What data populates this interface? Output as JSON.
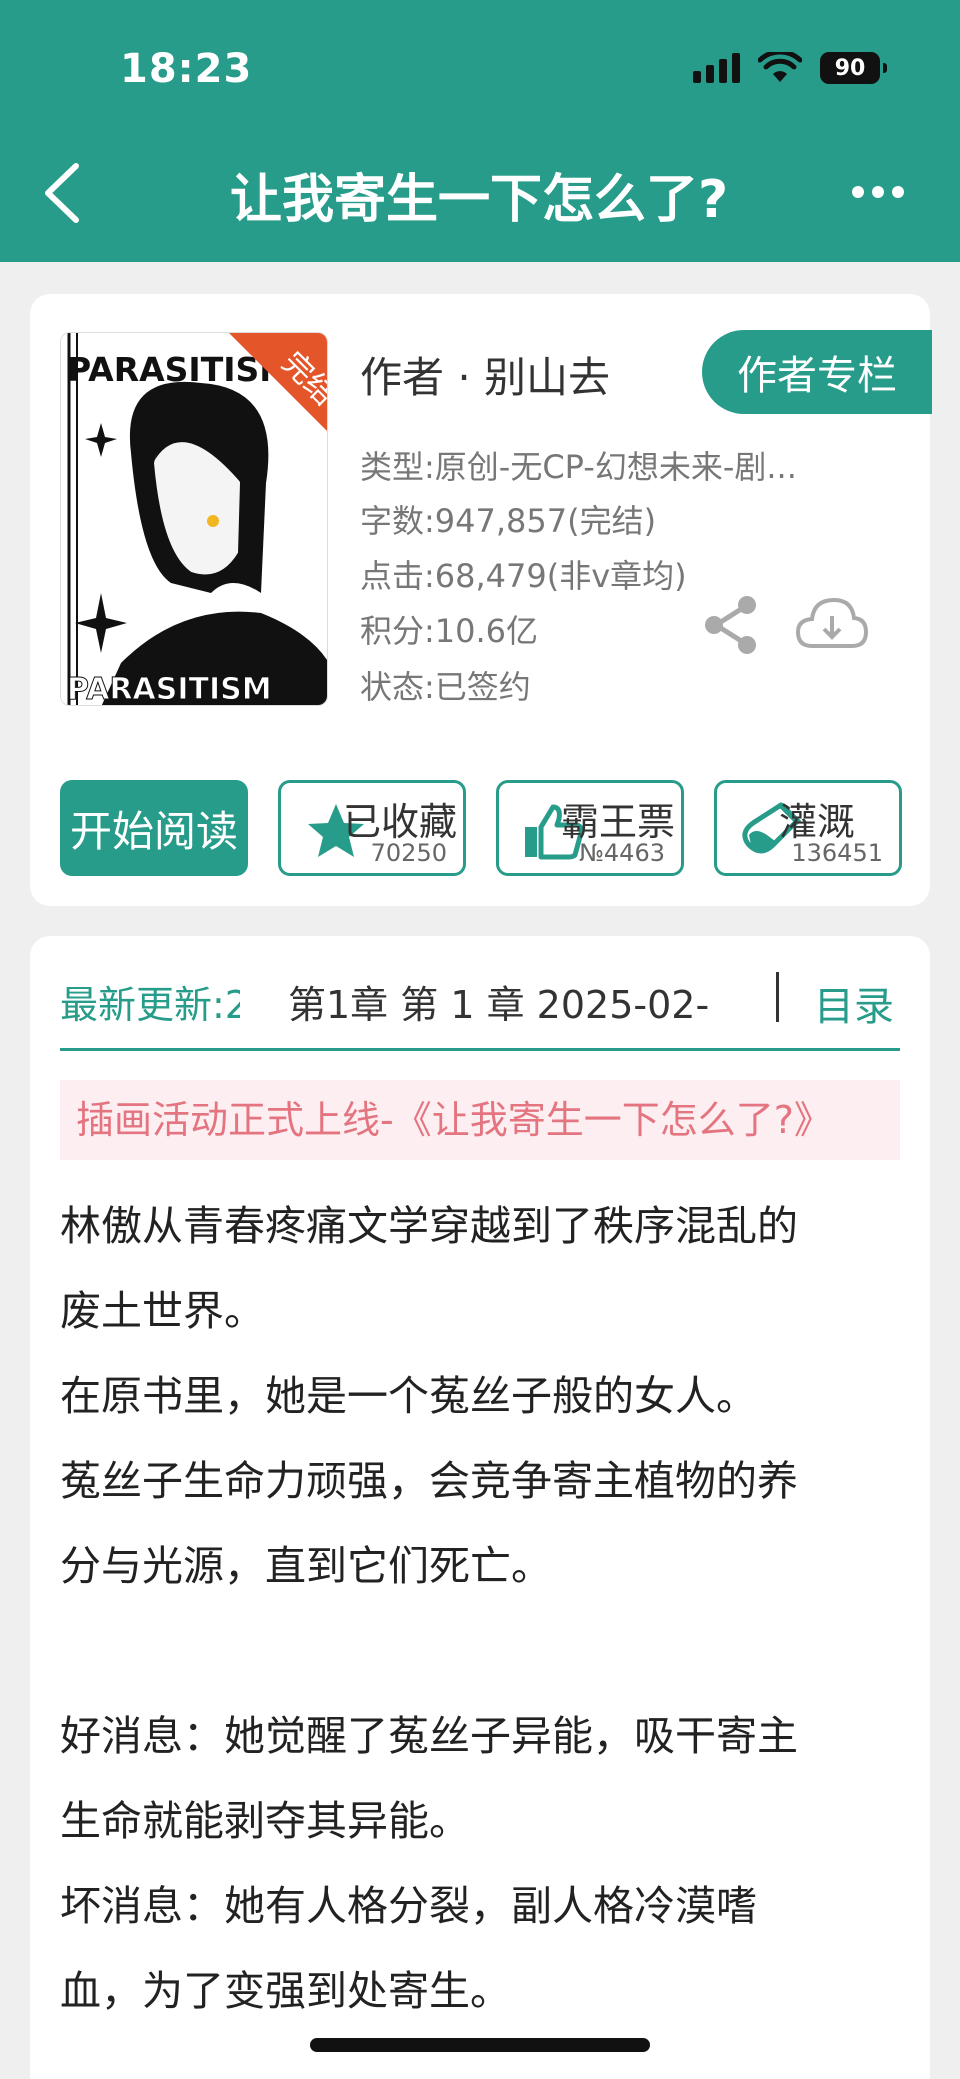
{
  "status": {
    "time": "18:23",
    "battery": "90"
  },
  "nav": {
    "title": "让我寄生一下怎么了?"
  },
  "book": {
    "cover_text_top": "PARASITISM",
    "cover_text_bottom": "PARASITISM",
    "cover_badge": "完结",
    "author": "作者 · 别山去",
    "author_column_button": "作者专栏",
    "type": "类型:原创-无CP-幻想未来-剧...",
    "word_count": "字数:947,857(完结)",
    "clicks": "点击:68,479(非v章均)",
    "score": "积分:10.6亿",
    "status": "状态:已签约"
  },
  "actions": {
    "start_reading": "开始阅读",
    "collected_label": "已收藏",
    "collected_count": "70250",
    "vote_label": "霸王票",
    "vote_count": "№4463",
    "nutrient_label": "灌溉",
    "nutrient_count": "136451"
  },
  "update": {
    "label": "最新更新:2",
    "text": "第1章 第 1 章 2025-02-",
    "toc": "目录"
  },
  "promo": "插画活动正式上线-《让我寄生一下怎么了?》",
  "intro": "林傲从青春疼痛文学穿越到了秩序混乱的\n废土世界。\n在原书里，她是一个菟丝子般的女人。\n菟丝子生命力顽强，会竞争寄主植物的养\n分与光源，直到它们死亡。\n\n好消息：她觉醒了菟丝子异能，吸干寄主\n生命就能剥夺其异能。\n坏消息：她有人格分裂，副人格冷漠嗜\n血，为了变强到处寄生。",
  "colors": {
    "accent": "#279c8a",
    "promo_bg": "#fdeef1",
    "promo_text": "#e47580",
    "badge": "#e4552a"
  },
  "icons": [
    "back-icon",
    "more-icon",
    "share-icon",
    "cloud-download-icon",
    "star-icon",
    "thumbs-up-icon",
    "flask-icon"
  ]
}
